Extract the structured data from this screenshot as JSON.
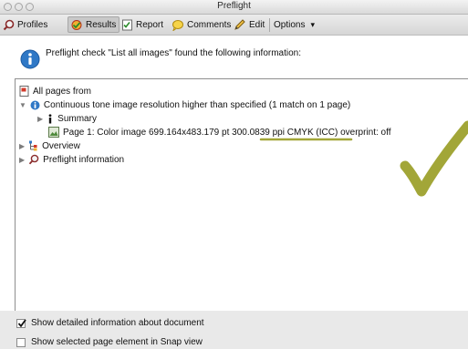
{
  "window": {
    "title": "Preflight"
  },
  "toolbar": {
    "profiles": "Profiles",
    "results": "Results",
    "report": "Report",
    "comments": "Comments",
    "edit": "Edit",
    "options": "Options",
    "options_arrow": "▾"
  },
  "message": "Preflight check \"List all images\" found the following information:",
  "tree": {
    "all_pages": "All pages from",
    "continuous": "Continuous tone image resolution higher than specified (1 match on 1 page)",
    "summary": "Summary",
    "page_item": "Page 1: Color image 699.164x483.179 pt 300.0839 ppi CMYK (ICC) overprint: off",
    "overview": "Overview",
    "preflight_info": "Preflight information"
  },
  "options": {
    "show_detailed": "Show detailed information about document",
    "show_detailed_checked": true,
    "show_selected": "Show selected page element in Snap view",
    "show_selected_checked": false
  },
  "colors": {
    "checkmark": "#a2a638",
    "highlight_line": "#a2a638",
    "info_blue": "#2f78c6"
  }
}
